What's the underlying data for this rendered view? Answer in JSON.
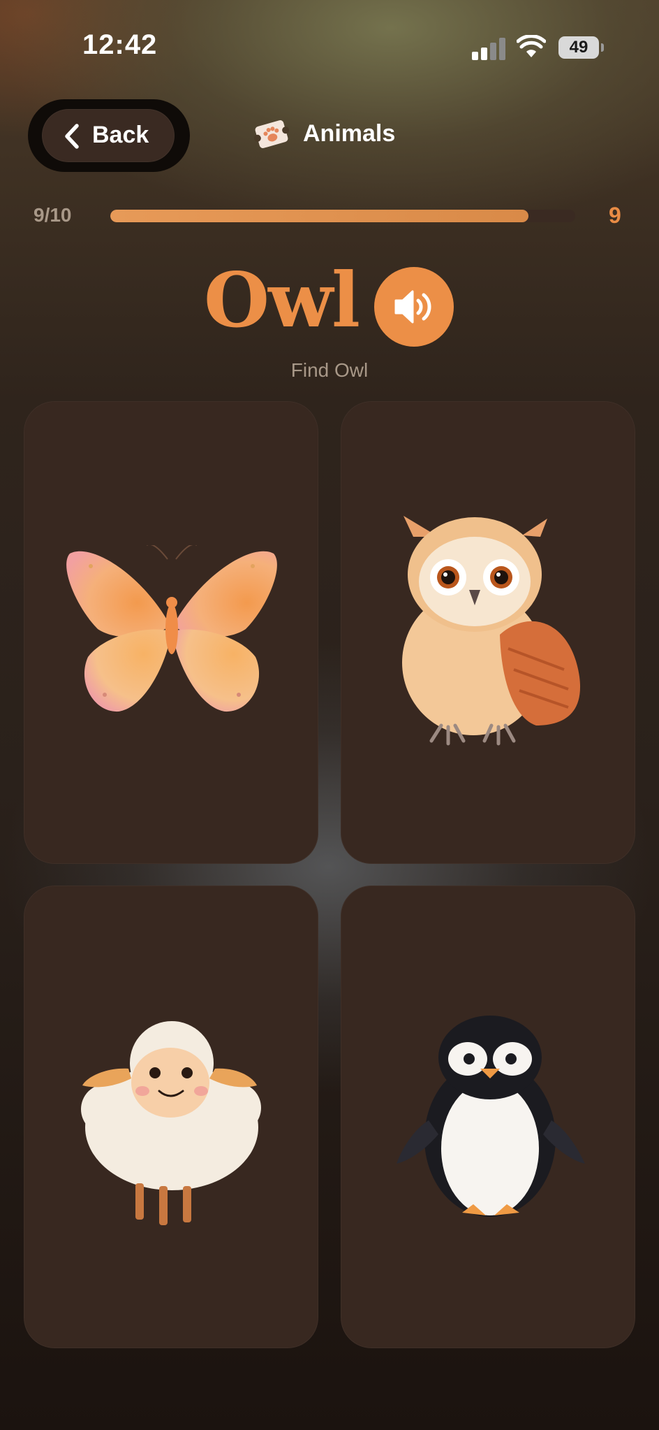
{
  "status_bar": {
    "time": "12:42",
    "battery": "49",
    "icons": [
      "signal-icon",
      "wifi-icon",
      "battery-icon"
    ]
  },
  "header": {
    "back_label": "Back",
    "category_icon": "paw-ticket-icon",
    "category_title": "Animals"
  },
  "progress": {
    "label": "9/10",
    "fraction": 0.9,
    "score": "9"
  },
  "question": {
    "word": "Owl",
    "sound_icon": "speaker-icon",
    "instruction": "Find Owl"
  },
  "cards": [
    {
      "animal": "butterfly",
      "icon": "butterfly-illustration"
    },
    {
      "animal": "owl",
      "icon": "owl-illustration"
    },
    {
      "animal": "sheep",
      "icon": "sheep-illustration"
    },
    {
      "animal": "penguin",
      "icon": "penguin-illustration"
    }
  ],
  "colors": {
    "accent": "#ec8f47",
    "card": "#382820",
    "background": "#1c1410",
    "muted_text": "#a89888"
  }
}
